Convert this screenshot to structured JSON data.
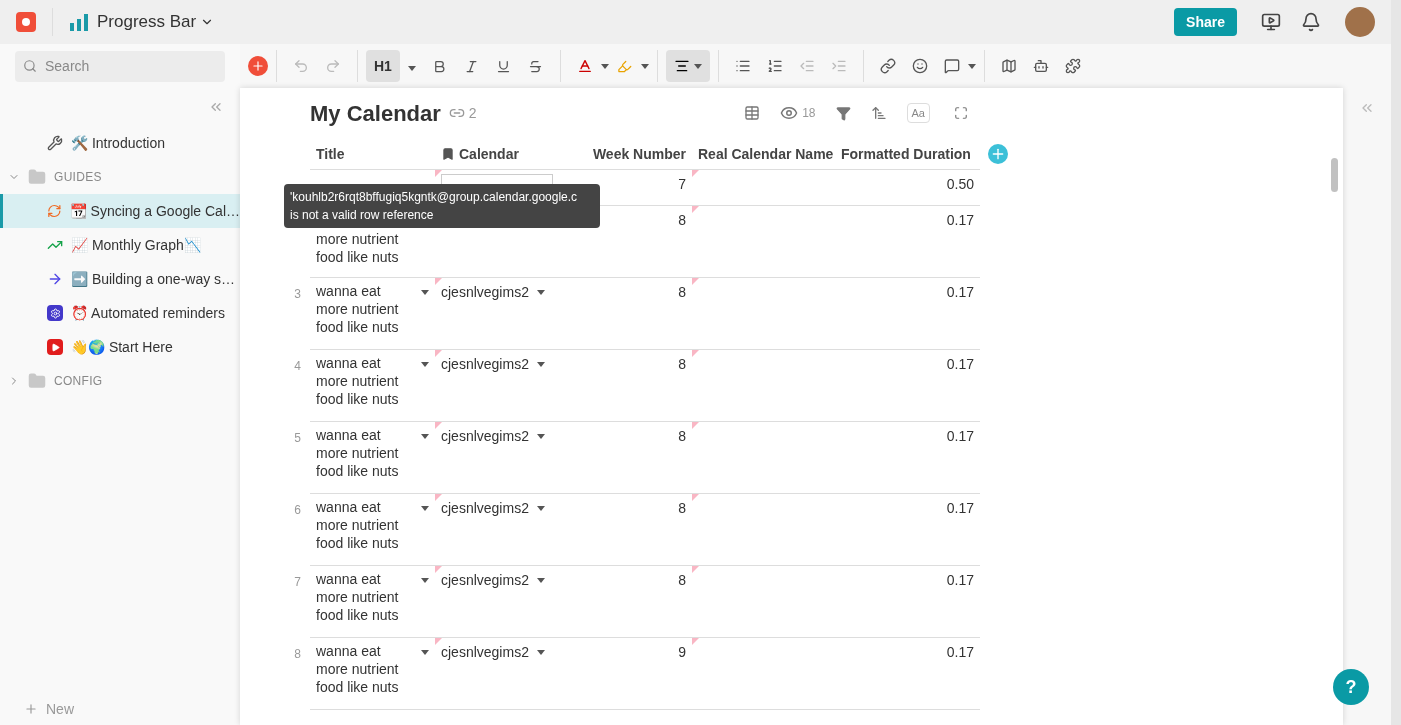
{
  "topbar": {
    "doc_title": "Progress Bar",
    "share": "Share"
  },
  "toolbar": {
    "search_placeholder": "Search",
    "heading": "H1",
    "heading_active": true
  },
  "sidebar": {
    "items": [
      {
        "kind": "page",
        "label": "🛠️ Introduction",
        "selected": false
      },
      {
        "kind": "folder",
        "label": "GUIDES",
        "expanded": true,
        "children": [
          {
            "kind": "page",
            "label": "📆 Syncing a Google Cal…",
            "selected": true
          },
          {
            "kind": "page",
            "label": "📈 Monthly Graph📉",
            "selected": false
          },
          {
            "kind": "page",
            "label": "➡️ Building a one-way s…",
            "selected": false
          },
          {
            "kind": "page",
            "label": "⏰ Automated reminders",
            "selected": false
          },
          {
            "kind": "page",
            "label": "👋🌍 Start Here",
            "selected": false
          }
        ]
      },
      {
        "kind": "folder",
        "label": "CONFIG",
        "expanded": false
      }
    ],
    "new": "New"
  },
  "table": {
    "title": "My Calendar",
    "link_count": "2",
    "view_count": "18",
    "text_toggle": "Aa",
    "columns": [
      "Title",
      "Calendar",
      "Week Number",
      "Real Calendar Name",
      "Formatted Duration"
    ],
    "rows": [
      {
        "num": "",
        "title": "",
        "calendar": "",
        "editing": true,
        "week": "7",
        "duration": "0.50"
      },
      {
        "num": "",
        "title": "more nutrient food like nuts",
        "calendar": "",
        "editing": false,
        "covered": true,
        "week": "8",
        "duration": "0.17"
      },
      {
        "num": "3",
        "title": "wanna eat more nutrient food like nuts",
        "calendar": "cjesnlvegims2",
        "editing": false,
        "week": "8",
        "duration": "0.17"
      },
      {
        "num": "4",
        "title": "wanna eat more nutrient food like nuts",
        "calendar": "cjesnlvegims2",
        "editing": false,
        "week": "8",
        "duration": "0.17"
      },
      {
        "num": "5",
        "title": "wanna eat more nutrient food like nuts",
        "calendar": "cjesnlvegims2",
        "editing": false,
        "week": "8",
        "duration": "0.17"
      },
      {
        "num": "6",
        "title": "wanna eat more nutrient food like nuts",
        "calendar": "cjesnlvegims2",
        "editing": false,
        "week": "8",
        "duration": "0.17"
      },
      {
        "num": "7",
        "title": "wanna eat more nutrient food like nuts",
        "calendar": "cjesnlvegims2",
        "editing": false,
        "week": "8",
        "duration": "0.17"
      },
      {
        "num": "8",
        "title": "wanna eat more nutrient food like nuts",
        "calendar": "cjesnlvegims2",
        "editing": false,
        "week": "9",
        "duration": "0.17"
      }
    ],
    "tooltip": [
      "'kouhlb2r6rqt8bffugiq5kgntk@group.calendar.google.c",
      "is not a valid row reference"
    ]
  },
  "help": "?"
}
